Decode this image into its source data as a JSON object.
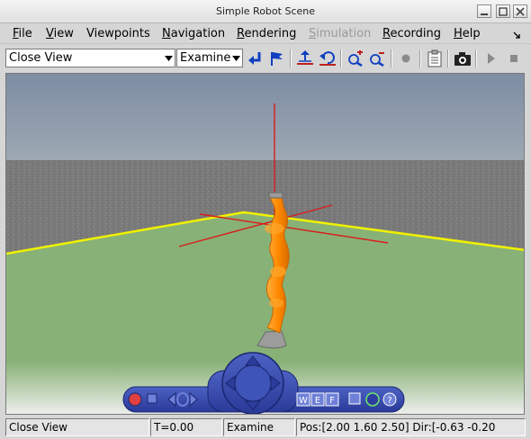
{
  "window": {
    "title": "Simple Robot Scene"
  },
  "menubar": {
    "items": [
      {
        "label": "File",
        "underline": "F",
        "rest": "ile",
        "enabled": true
      },
      {
        "label": "View",
        "underline": "V",
        "rest": "iew",
        "enabled": true
      },
      {
        "label": "Viewpoints",
        "underline": "",
        "rest": "Viewpoints",
        "enabled": true
      },
      {
        "label": "Navigation",
        "underline": "N",
        "rest": "avigation",
        "enabled": true
      },
      {
        "label": "Rendering",
        "underline": "R",
        "rest": "endering",
        "enabled": true
      },
      {
        "label": "Simulation",
        "underline": "S",
        "rest": "imulation",
        "enabled": false
      },
      {
        "label": "Recording",
        "underline": "R",
        "rest": "ecording",
        "enabled": true
      },
      {
        "label": "Help",
        "underline": "H",
        "rest": "elp",
        "enabled": true
      }
    ]
  },
  "toolbar": {
    "viewpoint_select": "Close View",
    "navigation_select": "Examine",
    "icons": [
      "return-icon",
      "flag-icon",
      "straighten-icon",
      "undo-move-icon",
      "zoom-in-icon",
      "zoom-out-icon",
      "record-icon",
      "clipboard-icon",
      "camera-icon",
      "play-icon",
      "stop-icon"
    ]
  },
  "navigator": {
    "w_label": "W",
    "e_label": "E",
    "f_label": "F",
    "help_label": "?"
  },
  "statusbar": {
    "viewpoint": "Close View",
    "time": "T=0.00",
    "mode": "Examine",
    "position": "Pos:[2.00 1.60 2.50] Dir:[-0.63 -0.20"
  },
  "colors": {
    "sky_top": "#7b8da2",
    "ground": "#88b177",
    "wall": "#7a7a7a",
    "robot": "#f98a00",
    "axis": "#d81c1c",
    "boundary": "#f1f100",
    "navigator": "#3a4fb0"
  }
}
